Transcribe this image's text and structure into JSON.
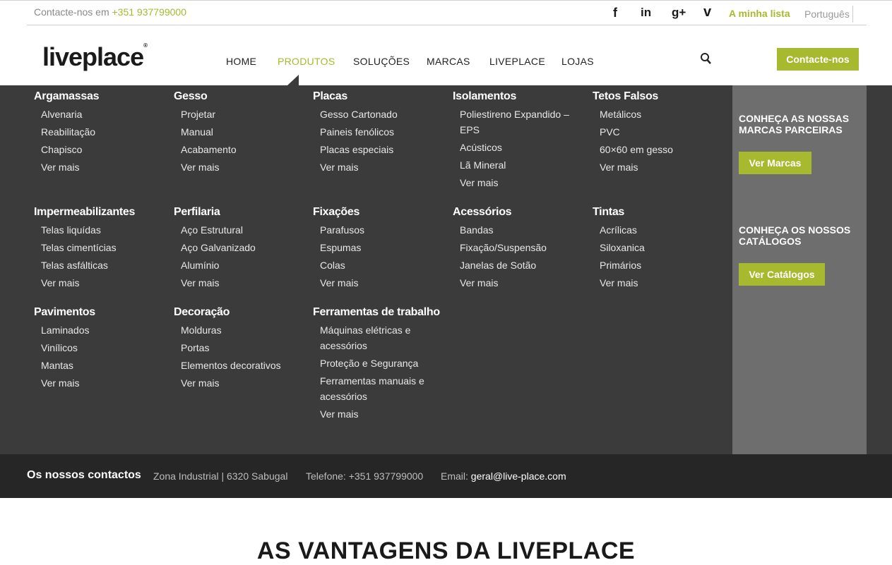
{
  "topbar": {
    "phone_label": "Contacte-nos em",
    "phone_number": "+351 937799000",
    "social": [
      "f",
      "in",
      "g+",
      "v"
    ],
    "my_list": "A minha lista",
    "language": "Português"
  },
  "header": {
    "logo": "liveplace",
    "nav": [
      "HOME",
      "PRODUTOS",
      "SOLUÇÕES",
      "MARCAS",
      "LIVEPLACE",
      "LOJAS"
    ],
    "active_nav": "PRODUTOS",
    "contact_button": "Contacte-nos"
  },
  "menu": {
    "row1": [
      {
        "title": "Argamassas",
        "items": [
          "Alvenaria",
          "Reabilitação",
          "Chapisco",
          "Ver mais"
        ]
      },
      {
        "title": "Gesso",
        "items": [
          "Projetar",
          "Manual",
          "Acabamento",
          "Ver mais"
        ]
      },
      {
        "title": "Placas",
        "items": [
          "Gesso Cartonado",
          "Paineis fenólicos",
          "Placas especiais",
          "Ver mais"
        ]
      },
      {
        "title": "Isolamentos",
        "items": [
          "Poliestireno Expandido –",
          "EPS",
          "Acústicos",
          "Lã Mineral",
          "Ver mais"
        ]
      },
      {
        "title": "Tetos Falsos",
        "items": [
          "Metálicos",
          "PVC",
          "60×60 em gesso",
          "Ver mais"
        ]
      }
    ],
    "row2": [
      {
        "title": "Impermeabilizantes",
        "items": [
          "Telas liquídas",
          "Telas cimentícias",
          "Telas asfálticas",
          "Ver mais"
        ]
      },
      {
        "title": "Perfilaria",
        "items": [
          "Aço Estrutural",
          "Aço Galvanizado",
          "Alumínio",
          "Ver mais"
        ]
      },
      {
        "title": "Fixações",
        "items": [
          "Parafusos",
          "Espumas",
          "Colas",
          "Ver mais"
        ]
      },
      {
        "title": "Acessórios",
        "items": [
          "Bandas",
          "Fixação/Suspensão",
          "Janelas de Sotão",
          "Ver mais"
        ]
      },
      {
        "title": "Tintas",
        "items": [
          "Acrílicas",
          "Siloxanica",
          "Primários",
          "Ver mais"
        ]
      }
    ],
    "row3": [
      {
        "title": "Pavimentos",
        "items": [
          "Laminados",
          "Vinílicos",
          "Mantas",
          "Ver mais"
        ]
      },
      {
        "title": "Decoração",
        "items": [
          "Molduras",
          "Portas",
          "Elementos decorativos",
          "Ver mais"
        ]
      },
      {
        "title": "Ferramentas de trabalho",
        "items": [
          "Máquinas elétricas e",
          "acessórios",
          "Proteção e Segurança",
          "Ferramentas manuais e",
          "acessórios",
          "Ver mais"
        ]
      }
    ],
    "side": {
      "brands_heading_1": "CONHEÇA AS NOSSAS",
      "brands_heading_2": "MARCAS PARCEIRAS",
      "brands_button": "Ver Marcas",
      "catalogs_heading_1": "CONHEÇA OS NOSSOS",
      "catalogs_heading_2": "CATÁLOGOS",
      "catalogs_button": "Ver Catálogos"
    }
  },
  "contacts": {
    "title": "Os nossos contactos",
    "address": "Zona Industrial | 6320 Sabugal",
    "phone_label": "Telefone:",
    "phone": "+351 937799000",
    "email_label": "Email:",
    "email": "geral@live-place.com"
  },
  "section_heading": "AS VANTAGENS DA LIVEPLACE",
  "colors": {
    "accent": "#a7b92e",
    "menu_bg": "#3b3b3c",
    "side_bg": "#6e6e6e",
    "contacts_bg": "#262626"
  }
}
